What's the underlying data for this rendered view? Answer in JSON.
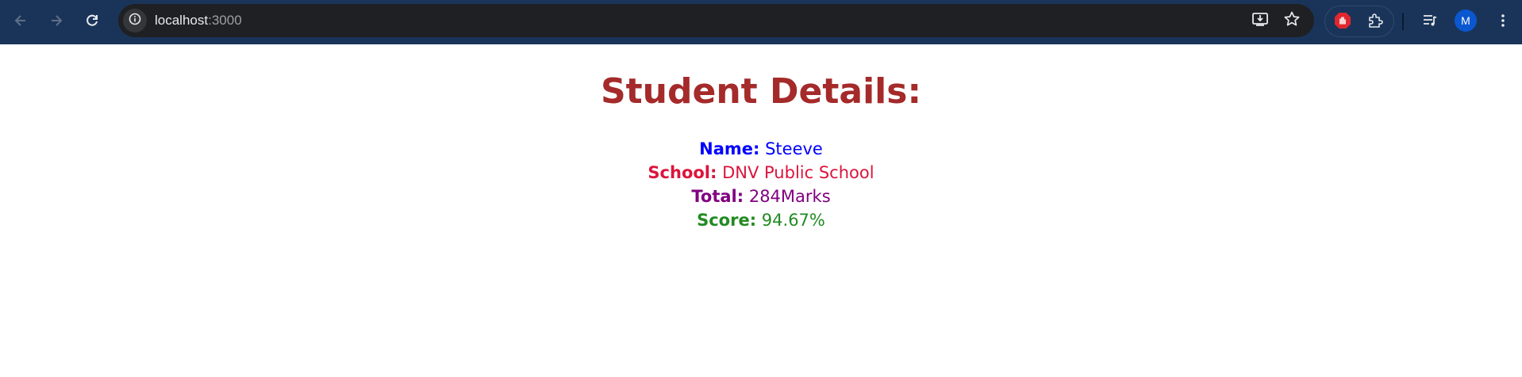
{
  "browser": {
    "url_host": "localhost",
    "url_port": ":3000",
    "profile_initial": "M",
    "icons": {
      "back": "arrow-left-icon",
      "forward": "arrow-right-icon",
      "reload": "reload-icon",
      "site_info": "info-icon",
      "install": "install-app-icon",
      "bookmark": "star-icon",
      "extension_blocker": "stop-hand-icon",
      "extensions": "puzzle-icon",
      "media": "media-queue-icon",
      "menu": "kebab-menu-icon"
    }
  },
  "page": {
    "title": "Student Details:",
    "fields": [
      {
        "label": "Name:",
        "value": "Steeve",
        "color": "#0000ff"
      },
      {
        "label": "School:",
        "value": "DNV Public School",
        "color": "#dc143c"
      },
      {
        "label": "Total:",
        "value": "284Marks",
        "color": "#800080"
      },
      {
        "label": "Score:",
        "value": "94.67%",
        "color": "#228b22"
      }
    ]
  },
  "colors": {
    "title": "#a52a2a",
    "toolbar": "#1a3459",
    "omnibox": "#1f2023"
  }
}
